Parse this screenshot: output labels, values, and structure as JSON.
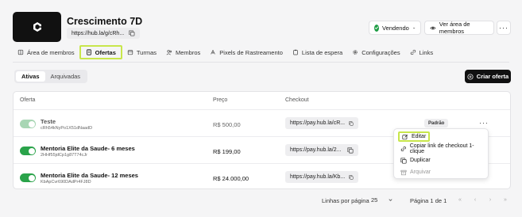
{
  "product": {
    "title": "Crescimento 7D",
    "url": "https://hub.la/g/cRh...",
    "logo_letter": "C"
  },
  "header_actions": {
    "status_label": "Vendendo",
    "view_members_label": "Ver área de membros"
  },
  "tabs": [
    {
      "label": "Área de membros",
      "icon": "book-icon",
      "active": false
    },
    {
      "label": "Ofertas",
      "icon": "receipt-icon",
      "active": true
    },
    {
      "label": "Turmas",
      "icon": "calendar-icon",
      "active": false
    },
    {
      "label": "Membros",
      "icon": "users-icon",
      "active": false
    },
    {
      "label": "Pixels de Rastreamento",
      "icon": "pixel-icon",
      "active": false
    },
    {
      "label": "Lista de espera",
      "icon": "clipboard-icon",
      "active": false
    },
    {
      "label": "Configurações",
      "icon": "gear-icon",
      "active": false
    },
    {
      "label": "Links",
      "icon": "link-icon",
      "active": false
    }
  ],
  "filter": {
    "active_label": "Ativas",
    "archived_label": "Arquivadas"
  },
  "create_button_label": "Criar oferta",
  "table": {
    "headers": {
      "offer": "Oferta",
      "price": "Preço",
      "checkout": "Checkout"
    },
    "rows": [
      {
        "name": "Teste",
        "code": "cRh54kNyPo1X51dNaadD",
        "price": "R$ 500,00",
        "checkout": "https://pay.hub.la/cR...",
        "badge": "Padrão",
        "enabled": true,
        "dimmed": true
      },
      {
        "name": "Mentoria Elite da Saude- 6 meses",
        "code": "2HHf55jdCp1g87T74cJr",
        "price": "R$ 199,00",
        "checkout": "https://pay.hub.la/2...",
        "badge": "",
        "enabled": true,
        "dimmed": false
      },
      {
        "name": "Mentoria Elite da Saude- 12 meses",
        "code": "KbApCvr690DAdPr4FJ8D",
        "price": "R$ 24.000,00",
        "checkout": "https://pay.hub.la/Kb...",
        "badge": "",
        "enabled": true,
        "dimmed": false
      }
    ]
  },
  "context_menu": {
    "edit": "Editar",
    "copy_link": "Copiar link de checkout 1-clique",
    "duplicate": "Duplicar",
    "archive": "Arquivar"
  },
  "pagination": {
    "rows_per_page_label": "Linhas por página",
    "rows_per_page_value": "25",
    "page_info": "Página 1 de 1"
  },
  "colors": {
    "highlight": "#c8e64b",
    "toggle_on": "#2aa34a",
    "primary_button": "#111111"
  }
}
